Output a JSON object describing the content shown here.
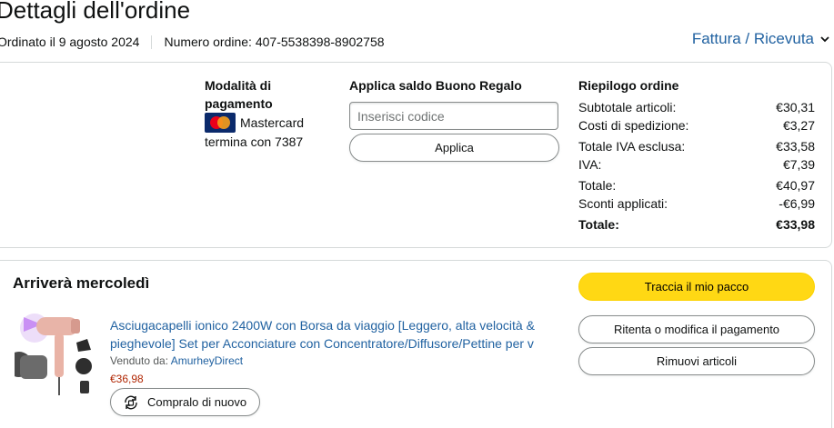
{
  "header": {
    "title": "Dettagli dell'ordine",
    "ordered_on": "Ordinato il 9 agosto 2024",
    "order_number": "Numero ordine: 407-5538398-8902758",
    "invoice_link": "Fattura / Ricevuta"
  },
  "payment": {
    "title": "Modalità di pagamento",
    "card_name": "Mastercard",
    "card_ending": "termina con 7387"
  },
  "gift_card": {
    "title": "Applica saldo Buono Regalo",
    "placeholder": "Inserisci codice",
    "apply_label": "Applica"
  },
  "summary": {
    "title": "Riepilogo ordine",
    "rows": [
      {
        "label": "Subtotale articoli:",
        "value": "€30,31"
      },
      {
        "label": "Costi di spedizione:",
        "value": "€3,27"
      },
      {
        "label": "Totale IVA esclusa:",
        "value": "€33,58"
      },
      {
        "label": "IVA:",
        "value": "€7,39"
      },
      {
        "label": "Totale:",
        "value": "€40,97"
      },
      {
        "label": "Sconti applicati:",
        "value": "-€6,99"
      }
    ],
    "grand_total_label": "Totale:",
    "grand_total_value": "€33,98"
  },
  "shipment": {
    "arrival": "Arriverà mercoledì",
    "track_label": "Traccia il mio pacco",
    "retry_label": "Ritenta o modifica il pagamento",
    "remove_label": "Rimuovi articoli"
  },
  "product": {
    "title": "Asciugacapelli ionico 2400W con Borsa da viaggio [Leggero, alta velocità & pieghevole] Set per Acconciature con Concentratore/Diffusore/Pettine per v",
    "sold_by_label": "Venduto da:",
    "seller": "AmurheyDirect",
    "price": "€36,98",
    "buy_again_label": "Compralo di nuovo"
  },
  "icons": {
    "card": "mastercard-logo",
    "chevron": "chevron-down-icon",
    "buy_again": "buy-again-icon"
  },
  "colors": {
    "link": "#2162a1",
    "price": "#b12704",
    "primary_button": "#ffd814"
  }
}
